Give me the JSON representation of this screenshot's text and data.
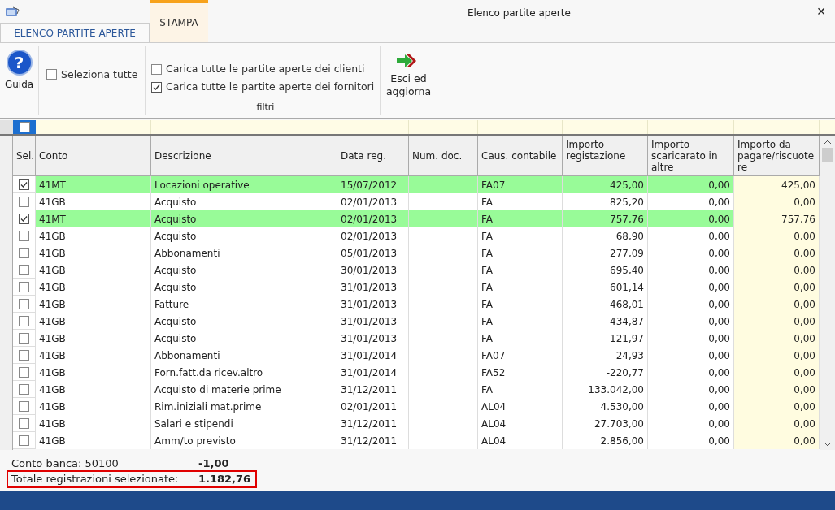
{
  "window": {
    "title": "Elenco partite aperte",
    "close": "✕"
  },
  "tabs": [
    {
      "label": "ELENCO PARTITE APERTE",
      "selected": true
    },
    {
      "label": "STAMPA",
      "selected": false
    }
  ],
  "ribbon": {
    "help_icon": "?",
    "help_button": "Guida",
    "select_all": {
      "label": "Seleziona tutte",
      "checked": false
    },
    "filters": [
      {
        "label": "Carica tutte le partite aperte dei clienti",
        "checked": false
      },
      {
        "label": "Carica tutte le partite aperte dei fornitori",
        "checked": true
      }
    ],
    "filters_group": "filtri",
    "exit_button": "Esci ed aggiorna"
  },
  "filter_row": {
    "checked": false
  },
  "table": {
    "columns": [
      "Sel.",
      "Conto",
      "Descrizione",
      "Data reg.",
      "Num. doc.",
      "Caus. contabile",
      "Importo registazione",
      "Importo scaricarato in altre",
      "Importo da pagare/riscuote re"
    ],
    "rows": [
      {
        "checked": true,
        "conto": "41MT",
        "descrizione": "Locazioni operative",
        "data": "15/07/2012",
        "causale": "FA07",
        "importo": "425,00",
        "scaricato": "0,00",
        "da_pagare": "425,00"
      },
      {
        "checked": false,
        "conto": "41GB",
        "descrizione": "Acquisto",
        "data": "02/01/2013",
        "causale": "FA",
        "importo": "825,20",
        "scaricato": "0,00",
        "da_pagare": "0,00"
      },
      {
        "checked": true,
        "conto": "41MT",
        "descrizione": "Acquisto",
        "data": "02/01/2013",
        "causale": "FA",
        "importo": "757,76",
        "scaricato": "0,00",
        "da_pagare": "757,76"
      },
      {
        "checked": false,
        "conto": "41GB",
        "descrizione": "Acquisto",
        "data": "02/01/2013",
        "causale": "FA",
        "importo": "68,90",
        "scaricato": "0,00",
        "da_pagare": "0,00"
      },
      {
        "checked": false,
        "conto": "41GB",
        "descrizione": "Abbonamenti",
        "data": "05/01/2013",
        "causale": "FA",
        "importo": "277,09",
        "scaricato": "0,00",
        "da_pagare": "0,00"
      },
      {
        "checked": false,
        "conto": "41GB",
        "descrizione": "Acquisto",
        "data": "30/01/2013",
        "causale": "FA",
        "importo": "695,40",
        "scaricato": "0,00",
        "da_pagare": "0,00"
      },
      {
        "checked": false,
        "conto": "41GB",
        "descrizione": "Acquisto",
        "data": "31/01/2013",
        "causale": "FA",
        "importo": "601,14",
        "scaricato": "0,00",
        "da_pagare": "0,00"
      },
      {
        "checked": false,
        "conto": "41GB",
        "descrizione": "Fatture",
        "data": "31/01/2013",
        "causale": "FA",
        "importo": "468,01",
        "scaricato": "0,00",
        "da_pagare": "0,00"
      },
      {
        "checked": false,
        "conto": "41GB",
        "descrizione": "Acquisto",
        "data": "31/01/2013",
        "causale": "FA",
        "importo": "434,87",
        "scaricato": "0,00",
        "da_pagare": "0,00"
      },
      {
        "checked": false,
        "conto": "41GB",
        "descrizione": "Acquisto",
        "data": "31/01/2013",
        "causale": "FA",
        "importo": "121,97",
        "scaricato": "0,00",
        "da_pagare": "0,00"
      },
      {
        "checked": false,
        "conto": "41GB",
        "descrizione": "Abbonamenti",
        "data": "31/01/2014",
        "causale": "FA07",
        "importo": "24,93",
        "scaricato": "0,00",
        "da_pagare": "0,00"
      },
      {
        "checked": false,
        "conto": "41GB",
        "descrizione": "Forn.fatt.da ricev.altro",
        "data": "31/01/2014",
        "causale": "FA52",
        "importo": "-220,77",
        "scaricato": "0,00",
        "da_pagare": "0,00"
      },
      {
        "checked": false,
        "conto": "41GB",
        "descrizione": "Acquisto di materie prime",
        "data": "31/12/2011",
        "causale": "FA",
        "importo": "133.042,00",
        "scaricato": "0,00",
        "da_pagare": "0,00"
      },
      {
        "checked": false,
        "conto": "41GB",
        "descrizione": "Rim.iniziali mat.prime",
        "data": "02/01/2011",
        "causale": "AL04",
        "importo": "4.530,00",
        "scaricato": "0,00",
        "da_pagare": "0,00"
      },
      {
        "checked": false,
        "conto": "41GB",
        "descrizione": "Salari e stipendi",
        "data": "31/12/2011",
        "causale": "AL04",
        "importo": "27.703,00",
        "scaricato": "0,00",
        "da_pagare": "0,00"
      },
      {
        "checked": false,
        "conto": "41GB",
        "descrizione": "Amm/to previsto",
        "data": "31/12/2011",
        "causale": "AL04",
        "importo": "2.856,00",
        "scaricato": "0,00",
        "da_pagare": "0,00"
      }
    ]
  },
  "footer": {
    "bank_label": "Conto banca: 50100",
    "bank_value": "-1,00",
    "total_label": "Totale registrazioni selezionate:",
    "total_value": "1.182,76"
  }
}
